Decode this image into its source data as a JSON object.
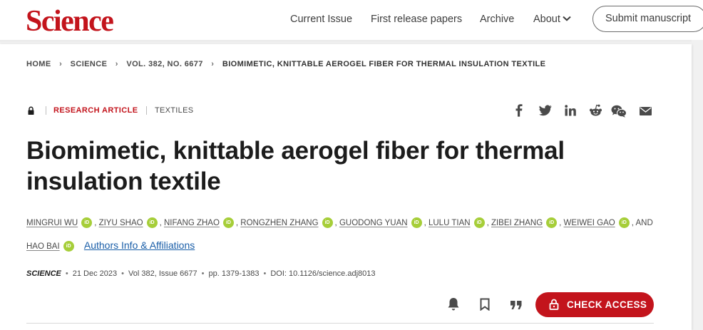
{
  "header": {
    "logo": "Science",
    "nav": {
      "current_issue": "Current Issue",
      "first_release": "First release papers",
      "archive": "Archive",
      "about": "About"
    },
    "submit_label": "Submit manuscript"
  },
  "breadcrumb": [
    "HOME",
    "SCIENCE",
    "VOL. 382, NO. 6677",
    "BIOMIMETIC, KNITTABLE AEROGEL FIBER FOR THERMAL INSULATION TEXTILE"
  ],
  "article": {
    "type": "RESEARCH ARTICLE",
    "topic": "TEXTILES",
    "title_line1": "Biomimetic, knittable aerogel fiber for thermal",
    "title_line2": "insulation textile",
    "authors": [
      "MINGRUI WU",
      "ZIYU SHAO",
      "NIFANG ZHAO",
      "RONGZHEN ZHANG",
      "GUODONG YUAN",
      "LULU TIAN",
      "ZIBEI ZHANG",
      "WEIWEI GAO",
      "HAO BAI"
    ],
    "and_text": ", AND",
    "orcid_label": "iD",
    "authors_info": "Authors Info & Affiliations"
  },
  "meta": {
    "journal": "SCIENCE",
    "date": "21 Dec 2023",
    "volume": "Vol 382, Issue 6677",
    "pages": "pp. 1379-1383",
    "doi": "DOI: 10.1126/science.adj8013"
  },
  "actions": {
    "check_access": "CHECK ACCESS"
  },
  "icons": {
    "share": [
      "facebook-icon",
      "twitter-icon",
      "linkedin-icon",
      "reddit-icon",
      "wechat-icon",
      "email-icon"
    ],
    "tools": [
      "bell-icon",
      "bookmark-icon",
      "quote-icon"
    ]
  },
  "colors": {
    "brand_red": "#c3141c",
    "orcid_green": "#a6ce39",
    "link_blue": "#1a5ea8"
  }
}
